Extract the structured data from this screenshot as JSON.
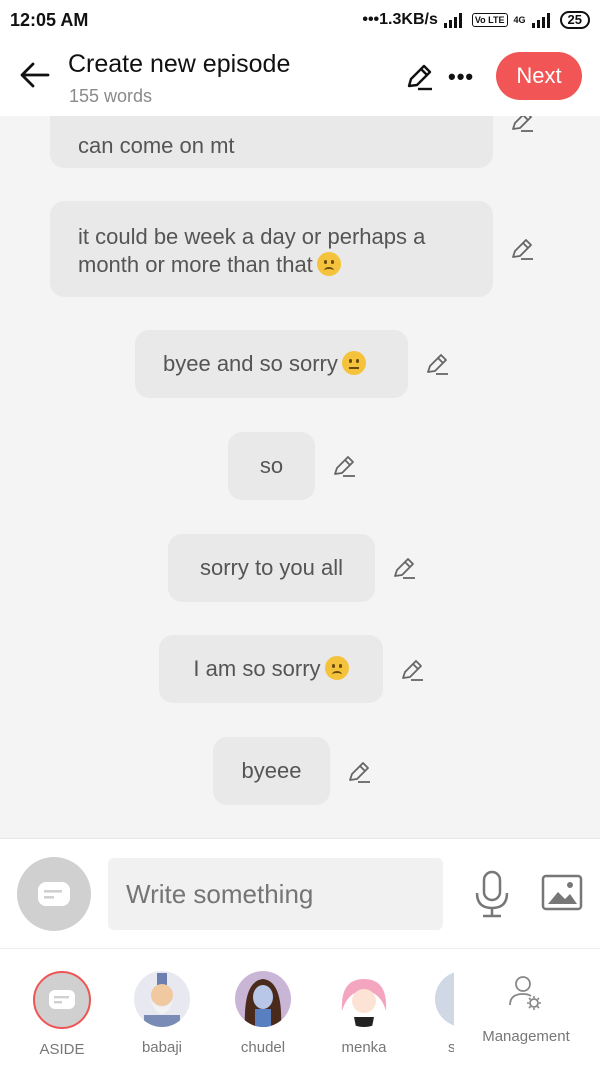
{
  "status_bar": {
    "time": "12:05 AM",
    "speed": "•••1.3KB/s",
    "volte": "Vo LTE",
    "network": "4G",
    "battery": "25"
  },
  "header": {
    "title": "Create new episode",
    "word_count": "155 words",
    "next_label": "Next"
  },
  "messages": [
    {
      "text_line1": "can come on mt"
    },
    {
      "text_line1": "it could be week a day or perhaps a",
      "text_line2": "month or more than that",
      "emoji": "frowning-face"
    },
    {
      "text": "byee and so sorry",
      "emoji": "neutral-face"
    },
    {
      "text": "so"
    },
    {
      "text": "sorry to you all"
    },
    {
      "text": "I am so sorry",
      "emoji": "frowning-face"
    },
    {
      "text": "byeee"
    }
  ],
  "composer": {
    "placeholder": "Write something"
  },
  "characters": [
    {
      "name": "ASIDE"
    },
    {
      "name": "babaji"
    },
    {
      "name": "chudel"
    },
    {
      "name": "menka"
    },
    {
      "name": "s"
    }
  ],
  "management_label": "Management",
  "colors": {
    "accent": "#f25555",
    "bubble": "#e9e9e9",
    "background": "#f4f4f4"
  }
}
